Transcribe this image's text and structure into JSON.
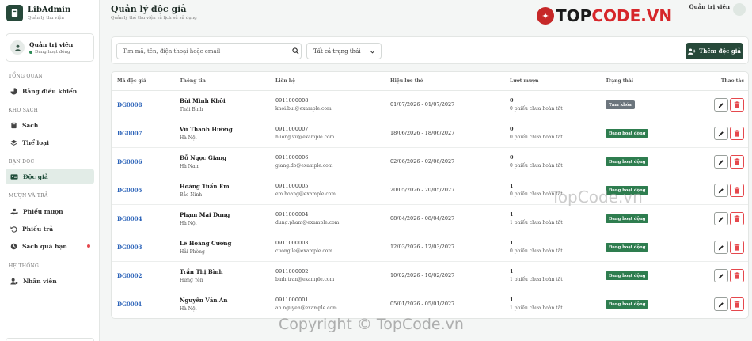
{
  "brand": {
    "name": "LibAdmin",
    "subtitle": "Quản lý thư viện"
  },
  "user": {
    "name": "Quản trị viên",
    "status": "Đang hoạt động"
  },
  "nav": {
    "group_overview": "TỔNG QUAN",
    "dashboard": "Bảng điều khiển",
    "group_warehouse": "KHO SÁCH",
    "books": "Sách",
    "categories": "Thể loại",
    "group_readers": "BẠN ĐỌC",
    "readers": "Độc giả",
    "group_loans": "MƯỢN VÀ TRẢ",
    "borrow": "Phiếu mượn",
    "returns": "Phiếu trả",
    "overdue": "Sách quá hạn",
    "group_system": "HỆ THỐNG",
    "staff": "Nhân viên"
  },
  "header": {
    "title": "Quản lý độc giả",
    "subtitle": "Quản lý thẻ thư viện và lịch sử sử dụng",
    "account": "Quản trị viên"
  },
  "toolbar": {
    "search_placeholder": "Tìm mã, tên, điện thoại hoặc email",
    "status_filter": "Tất cả trạng thái",
    "add_label": "Thêm độc giả"
  },
  "table": {
    "headers": {
      "code": "Mã độc giả",
      "info": "Thông tin",
      "contact": "Liên hệ",
      "validity": "Hiệu lực thẻ",
      "loans": "Lượt mượn",
      "status": "Trạng thái",
      "actions": "Thao tác"
    },
    "rows": [
      {
        "code": "DG0008",
        "name": "Bùi Minh Khôi",
        "place": "Thái Bình",
        "phone": "0911000008",
        "email": "khoi.bui@example.com",
        "validity": "01/07/2026 - 01/07/2027",
        "loans": "0",
        "loans_note": "0 phiếu chưa hoàn tất",
        "status": "Tạm khóa",
        "status_type": "paused"
      },
      {
        "code": "DG0007",
        "name": "Vũ Thanh Hương",
        "place": "Hà Nội",
        "phone": "0911000007",
        "email": "huong.vu@example.com",
        "validity": "18/06/2026 - 18/06/2027",
        "loans": "0",
        "loans_note": "0 phiếu chưa hoàn tất",
        "status": "Đang hoạt động",
        "status_type": "active"
      },
      {
        "code": "DG0006",
        "name": "Đỗ Ngọc Giang",
        "place": "Hà Nam",
        "phone": "0911000006",
        "email": "giang.do@example.com",
        "validity": "02/06/2026 - 02/06/2027",
        "loans": "0",
        "loans_note": "0 phiếu chưa hoàn tất",
        "status": "Đang hoạt động",
        "status_type": "active"
      },
      {
        "code": "DG0005",
        "name": "Hoàng Tuấn Em",
        "place": "Bắc Ninh",
        "phone": "0911000005",
        "email": "em.hoang@example.com",
        "validity": "20/05/2026 - 20/05/2027",
        "loans": "1",
        "loans_note": "0 phiếu chưa hoàn tất",
        "status": "Đang hoạt động",
        "status_type": "active"
      },
      {
        "code": "DG0004",
        "name": "Phạm Mai Dung",
        "place": "Hà Nội",
        "phone": "0911000004",
        "email": "dung.pham@example.com",
        "validity": "08/04/2026 - 08/04/2027",
        "loans": "1",
        "loans_note": "1 phiếu chưa hoàn tất",
        "status": "Đang hoạt động",
        "status_type": "active"
      },
      {
        "code": "DG0003",
        "name": "Lê Hoàng Cường",
        "place": "Hải Phòng",
        "phone": "0911000003",
        "email": "cuong.le@example.com",
        "validity": "12/03/2026 - 12/03/2027",
        "loans": "1",
        "loans_note": "0 phiếu chưa hoàn tất",
        "status": "Đang hoạt động",
        "status_type": "active"
      },
      {
        "code": "DG0002",
        "name": "Trần Thị Bình",
        "place": "Hưng Yên",
        "phone": "0911000002",
        "email": "binh.tran@example.com",
        "validity": "10/02/2026 - 10/02/2027",
        "loans": "1",
        "loans_note": "1 phiếu chưa hoàn tất",
        "status": "Đang hoạt động",
        "status_type": "active"
      },
      {
        "code": "DG0001",
        "name": "Nguyễn Văn An",
        "place": "Hà Nội",
        "phone": "0911000001",
        "email": "an.nguyen@example.com",
        "validity": "05/01/2026 - 05/01/2027",
        "loans": "1",
        "loans_note": "1 phiếu chưa hoàn tất",
        "status": "Đang hoạt động",
        "status_type": "active"
      }
    ]
  },
  "watermarks": {
    "logo_top": "TOP",
    "logo_code": "CODE.VN",
    "center": "TopCode.vn",
    "bottom": "Copyright © TopCode.vn"
  },
  "colors": {
    "primary": "#27493a",
    "link": "#2a62b8",
    "active_badge": "#2e7d4f",
    "paused_badge": "#6c757d",
    "danger": "#e5484d"
  }
}
